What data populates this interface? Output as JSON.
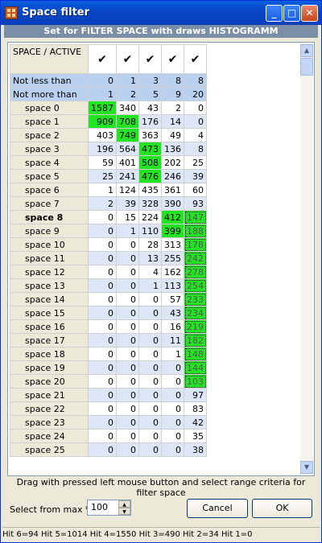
{
  "window": {
    "title": "Space filter"
  },
  "subheader": "Set for FILTER SPACE with draws HISTOGRAMM",
  "grid": {
    "corner_label": "SPACE / ACTIVE",
    "active_checks": [
      "✔",
      "✔",
      "✔",
      "✔",
      "✔"
    ],
    "config_rows": [
      {
        "label": "Not less than",
        "values": [
          "0",
          "1",
          "3",
          "8",
          "8"
        ]
      },
      {
        "label": "Not more than",
        "values": [
          "1",
          "2",
          "5",
          "9",
          "20"
        ]
      }
    ],
    "rows": [
      {
        "label": "space  0",
        "values": [
          "1587",
          "340",
          "43",
          "2",
          "0"
        ]
      },
      {
        "label": "space  1",
        "values": [
          "909",
          "708",
          "176",
          "14",
          "0"
        ]
      },
      {
        "label": "space  2",
        "values": [
          "403",
          "749",
          "363",
          "49",
          "4"
        ]
      },
      {
        "label": "space  3",
        "values": [
          "196",
          "564",
          "473",
          "136",
          "8"
        ]
      },
      {
        "label": "space  4",
        "values": [
          "59",
          "401",
          "508",
          "202",
          "25"
        ]
      },
      {
        "label": "space  5",
        "values": [
          "25",
          "241",
          "476",
          "246",
          "39"
        ]
      },
      {
        "label": "space  6",
        "values": [
          "1",
          "124",
          "435",
          "361",
          "60"
        ]
      },
      {
        "label": "space  7",
        "values": [
          "2",
          "39",
          "328",
          "390",
          "93"
        ]
      },
      {
        "label": "space  8",
        "values": [
          "0",
          "15",
          "224",
          "412",
          "147"
        ]
      },
      {
        "label": "space  9",
        "values": [
          "0",
          "1",
          "110",
          "399",
          "188"
        ]
      },
      {
        "label": "space 10",
        "values": [
          "0",
          "0",
          "28",
          "313",
          "178"
        ]
      },
      {
        "label": "space 11",
        "values": [
          "0",
          "0",
          "13",
          "255",
          "242"
        ]
      },
      {
        "label": "space 12",
        "values": [
          "0",
          "0",
          "4",
          "162",
          "278"
        ]
      },
      {
        "label": "space 13",
        "values": [
          "0",
          "0",
          "1",
          "113",
          "254"
        ]
      },
      {
        "label": "space 14",
        "values": [
          "0",
          "0",
          "0",
          "57",
          "233"
        ]
      },
      {
        "label": "space 15",
        "values": [
          "0",
          "0",
          "0",
          "43",
          "234"
        ]
      },
      {
        "label": "space 16",
        "values": [
          "0",
          "0",
          "0",
          "16",
          "219"
        ]
      },
      {
        "label": "space 17",
        "values": [
          "0",
          "0",
          "0",
          "11",
          "182"
        ]
      },
      {
        "label": "space 18",
        "values": [
          "0",
          "0",
          "0",
          "1",
          "148"
        ]
      },
      {
        "label": "space 19",
        "values": [
          "0",
          "0",
          "0",
          "0",
          "144"
        ]
      },
      {
        "label": "space 20",
        "values": [
          "0",
          "0",
          "0",
          "0",
          "103"
        ]
      },
      {
        "label": "space 21",
        "values": [
          "0",
          "0",
          "0",
          "0",
          "97"
        ]
      },
      {
        "label": "space 22",
        "values": [
          "0",
          "0",
          "0",
          "0",
          "83"
        ]
      },
      {
        "label": "space 23",
        "values": [
          "0",
          "0",
          "0",
          "0",
          "42"
        ]
      },
      {
        "label": "space 24",
        "values": [
          "0",
          "0",
          "0",
          "0",
          "35"
        ]
      },
      {
        "label": "space 25",
        "values": [
          "0",
          "0",
          "0",
          "0",
          "38"
        ]
      }
    ]
  },
  "hint": "Drag with pressed left mouse button and select range criteria for filter space",
  "select": {
    "label": "Select from max %",
    "value": "100"
  },
  "buttons": {
    "cancel": "Cancel",
    "ok": "OK"
  },
  "status": "Hit 6=94   Hit 5=1014   Hit 4=1550   Hit 3=490   Hit 2=34   Hit 1=0",
  "colors": {
    "highlight": "#22e422",
    "config_row": "#b9d0ee",
    "alt_row": "#dde6f6",
    "titlebar": "#0a5fe0"
  },
  "icons": {
    "close": "close-icon",
    "minimize": "minimize-icon",
    "maximize": "maximize-icon",
    "check": "check-icon"
  }
}
